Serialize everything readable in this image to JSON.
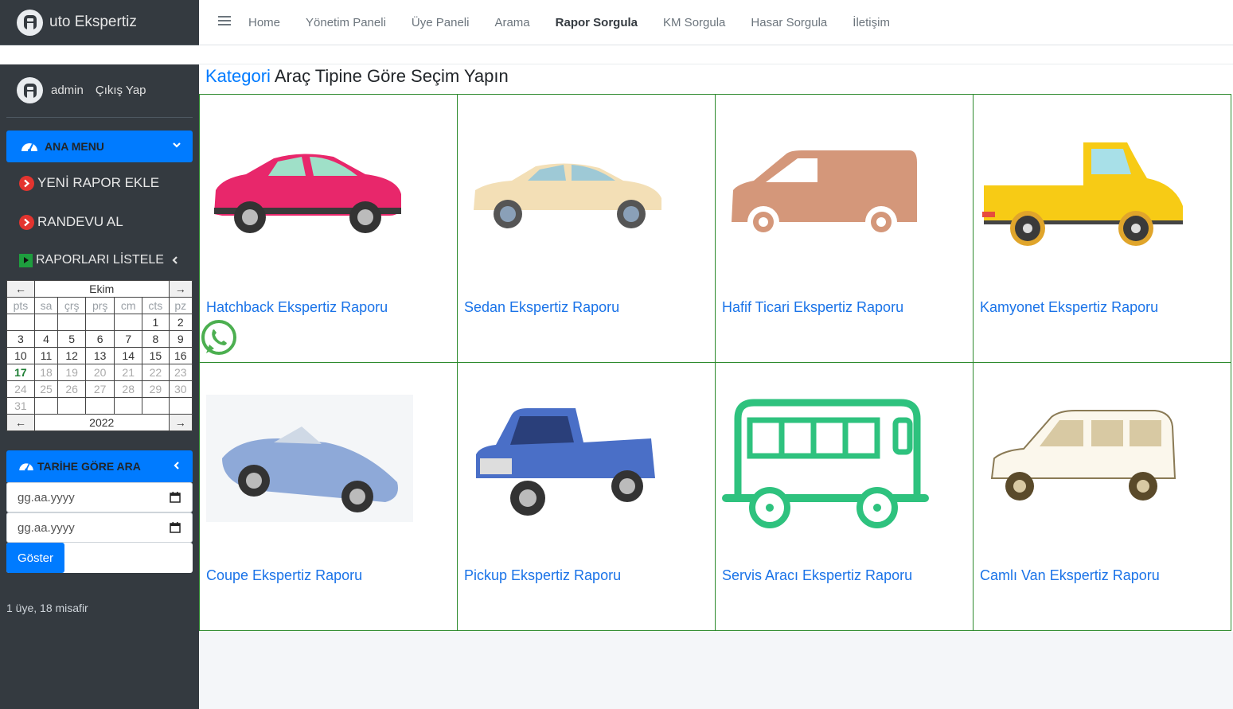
{
  "brand": {
    "text": "uto Ekspertiz",
    "logo_icon": "a-logo-icon"
  },
  "user": {
    "name": "admin",
    "logout": "Çıkış Yap"
  },
  "sidebar": {
    "main_menu": "ANA MENU",
    "items": [
      {
        "label": "YENİ RAPOR EKLE"
      },
      {
        "label": "RANDEVU AL"
      },
      {
        "label": "RAPORLARI LİSTELE"
      }
    ],
    "search_title": "TARİHE GÖRE ARA",
    "date_placeholder_1": "gg.aa.yyyy",
    "date_placeholder_2": "gg.aa.yyyy",
    "show_button": "Göster",
    "online": "1 üye, 18 misafir"
  },
  "calendar": {
    "month": "Ekim",
    "year": "2022",
    "prev": "←",
    "next": "→",
    "days": [
      "pts",
      "sa",
      "çrş",
      "prş",
      "cm",
      "cts",
      "pz"
    ],
    "weeks": [
      [
        "",
        "",
        "",
        "",
        "",
        "1",
        "2"
      ],
      [
        "3",
        "4",
        "5",
        "6",
        "7",
        "8",
        "9"
      ],
      [
        "10",
        "11",
        "12",
        "13",
        "14",
        "15",
        "16"
      ],
      [
        "17",
        "18",
        "19",
        "20",
        "21",
        "22",
        "23"
      ],
      [
        "24",
        "25",
        "26",
        "27",
        "28",
        "29",
        "30"
      ],
      [
        "31",
        "",
        "",
        "",
        "",
        "",
        ""
      ]
    ],
    "today": "17"
  },
  "topnav": {
    "links": [
      "Home",
      "Yönetim Paneli",
      "Üye Paneli",
      "Arama",
      "Rapor Sorgula",
      "KM Sorgula",
      "Hasar Sorgula",
      "İletişim"
    ],
    "active": "Rapor Sorgula"
  },
  "content": {
    "title_accent": "Kategori",
    "title_rest": " Araç Tipine Göre Seçim Yapın",
    "categories": [
      {
        "label": "Hatchback Ekspertiz Raporu",
        "icon": "hatchback-car-icon",
        "color": "#e8276b"
      },
      {
        "label": "Sedan Ekspertiz Raporu",
        "icon": "sedan-car-icon",
        "color": "#f3dfb6"
      },
      {
        "label": "Hafif Ticari Ekspertiz Raporu",
        "icon": "van-icon",
        "color": "#d4977a"
      },
      {
        "label": "Kamyonet Ekspertiz Raporu",
        "icon": "pickup-truck-icon",
        "color": "#f7cb15"
      },
      {
        "label": "Coupe Ekspertiz Raporu",
        "icon": "convertible-car-icon",
        "color": "#8ea9d8"
      },
      {
        "label": "Pickup Ekspertiz Raporu",
        "icon": "pickup-icon",
        "color": "#4a6fc7"
      },
      {
        "label": "Servis Aracı Ekspertiz Raporu",
        "icon": "bus-icon",
        "color": "#2ec27e"
      },
      {
        "label": "Camlı Van Ekspertiz Raporu",
        "icon": "glass-van-icon",
        "color": "#d8c9a3"
      }
    ]
  },
  "colors": {
    "primary": "#007bff",
    "sidebar": "#343a40",
    "grid_border": "#2d8a2d",
    "whatsapp": "#4caf50"
  }
}
